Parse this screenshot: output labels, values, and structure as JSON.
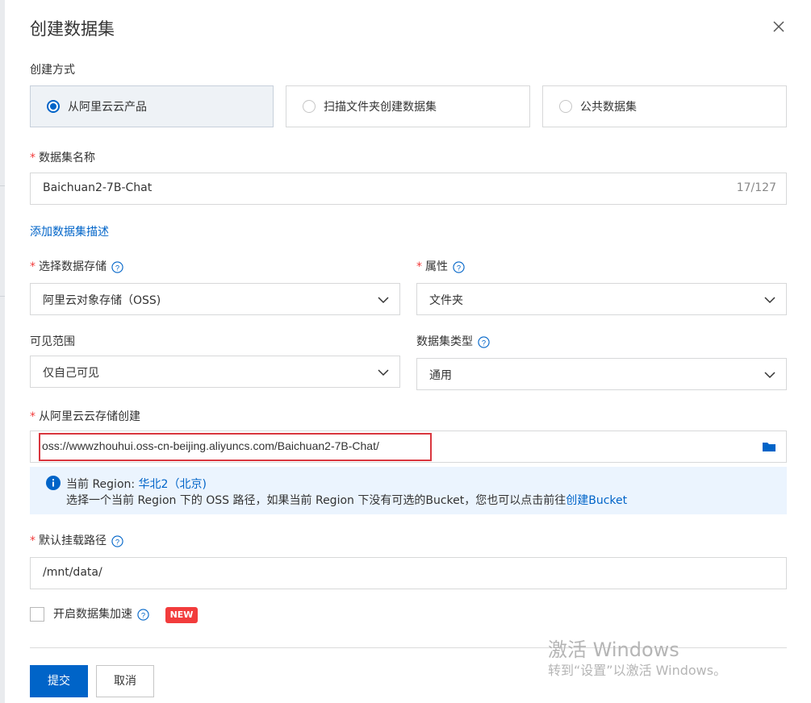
{
  "dialog": {
    "title": "创建数据集"
  },
  "creation_method": {
    "label": "创建方式",
    "options": [
      {
        "label": "从阿里云云产品",
        "selected": true
      },
      {
        "label": "扫描文件夹创建数据集",
        "selected": false
      },
      {
        "label": "公共数据集",
        "selected": false
      }
    ]
  },
  "dataset_name": {
    "label": "数据集名称",
    "value": "Baichuan2-7B-Chat",
    "counter": "17/127"
  },
  "add_description_link": "添加数据集描述",
  "storage": {
    "label": "选择数据存储",
    "value": "阿里云对象存储（OSS)"
  },
  "property": {
    "label": "属性",
    "value": "文件夹"
  },
  "visibility": {
    "label": "可见范围",
    "value": "仅自己可见"
  },
  "dataset_type": {
    "label": "数据集类型",
    "value": "通用"
  },
  "oss_source": {
    "label": "从阿里云云存储创建",
    "value": "oss://wwwzhouhui.oss-cn-beijing.aliyuncs.com/Baichuan2-7B-Chat/"
  },
  "region_info": {
    "prefix": "当前 Region: ",
    "region": "华北2（北京)",
    "line2_text": "选择一个当前 Region 下的 OSS 路径，如果当前 Region 下没有可选的Bucket，您也可以点击前往",
    "create_bucket_link": "创建Bucket"
  },
  "mount_path": {
    "label": "默认挂载路径",
    "value": "/mnt/data/"
  },
  "acceleration": {
    "label": "开启数据集加速",
    "badge": "NEW",
    "checked": false
  },
  "footer": {
    "submit_label": "提交",
    "cancel_label": "取消"
  },
  "watermark": {
    "line1": "激活 Windows",
    "line2": "转到“设置”以激活 Windows。"
  },
  "colors": {
    "primary": "#0064c8",
    "required": "#f23c3c",
    "info_bg": "#ebf4fe",
    "highlight_box": "#d9363e"
  }
}
